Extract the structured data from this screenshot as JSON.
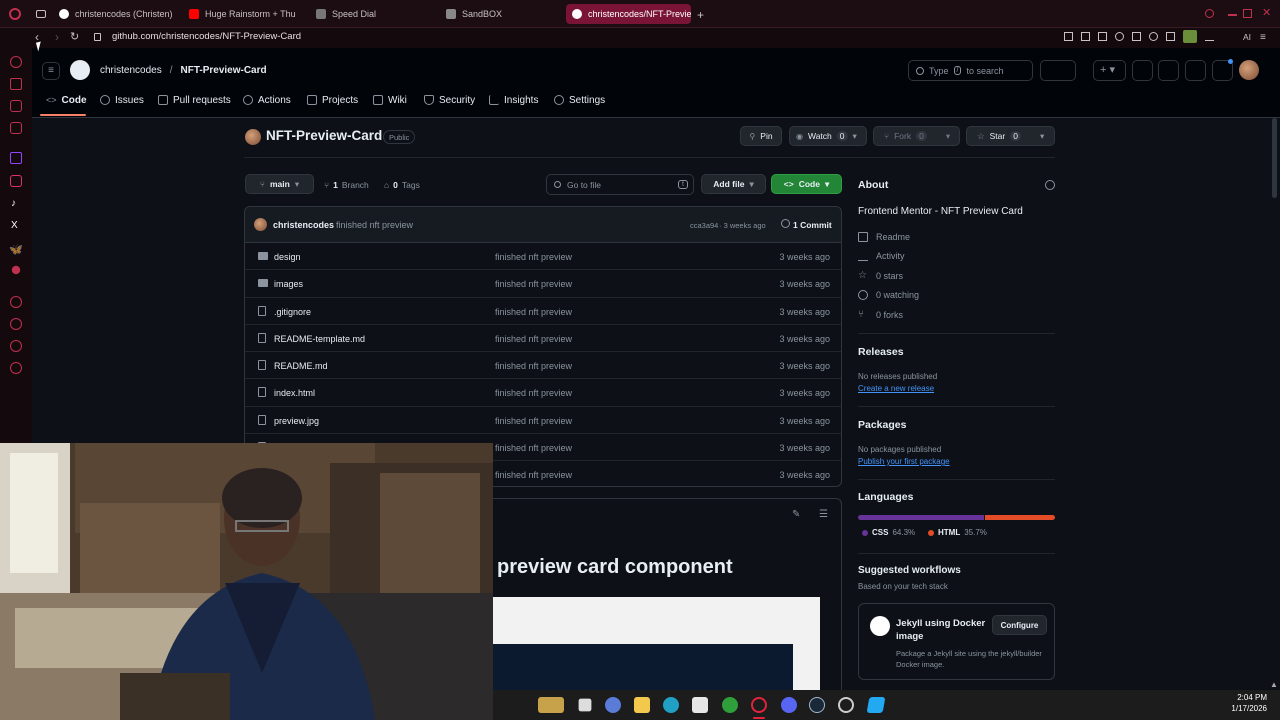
{
  "browser": {
    "tabs": [
      {
        "label": "christencodes (Christen)",
        "icon_color": "#ffffff"
      },
      {
        "label": "Huge Rainstorm + Thu",
        "icon_color": "#ff0000"
      },
      {
        "label": "Speed Dial",
        "icon_color": "#cfcfcf"
      },
      {
        "label": "SandBOX",
        "icon_color": "#cfcfcf"
      },
      {
        "label": "christencodes/NFT-Previe",
        "icon_color": "#ffffff",
        "active": true
      }
    ],
    "url": "github.com/christencodes/NFT-Preview-Card",
    "toolbar_ai": "AI",
    "accent": "#c0304f"
  },
  "header": {
    "owner": "christencodes",
    "separator": "/",
    "repo": "NFT-Preview-Card",
    "search_placeholder": "Type / to search",
    "search_key": "/",
    "search_prefix": "Type",
    "search_suffix": "to search"
  },
  "nav": {
    "tabs": [
      "Code",
      "Issues",
      "Pull requests",
      "Actions",
      "Projects",
      "Wiki",
      "Security",
      "Insights",
      "Settings"
    ]
  },
  "repo": {
    "title": "NFT-Preview-Card",
    "visibility": "Public",
    "pin": "Pin",
    "watch": "Watch",
    "watch_count": "0",
    "fork": "Fork",
    "fork_count": "0",
    "star": "Star",
    "star_count": "0"
  },
  "branchbar": {
    "branch": "main",
    "branches_count": "1",
    "branches_label": "Branch",
    "tags_count": "0",
    "tags_label": "Tags",
    "goto_placeholder": "Go to file",
    "goto_key": "t",
    "add_file": "Add file",
    "code": "Code"
  },
  "commit": {
    "author": "christencodes",
    "message": "finished nft preview",
    "hash": "cca3a94",
    "age": "· 3 weeks ago",
    "commits": "1 Commit"
  },
  "files": [
    {
      "name": "design",
      "type": "folder",
      "message": "finished nft preview",
      "date": "3 weeks ago"
    },
    {
      "name": "images",
      "type": "folder",
      "message": "finished nft preview",
      "date": "3 weeks ago"
    },
    {
      "name": ".gitignore",
      "type": "file",
      "message": "finished nft preview",
      "date": "3 weeks ago"
    },
    {
      "name": "README-template.md",
      "type": "file",
      "message": "finished nft preview",
      "date": "3 weeks ago"
    },
    {
      "name": "README.md",
      "type": "file",
      "message": "finished nft preview",
      "date": "3 weeks ago"
    },
    {
      "name": "index.html",
      "type": "file",
      "message": "finished nft preview",
      "date": "3 weeks ago"
    },
    {
      "name": "preview.jpg",
      "type": "file",
      "message": "finished nft preview",
      "date": "3 weeks ago"
    },
    {
      "name": "",
      "type": "file",
      "message": "finished nft preview",
      "date": "3 weeks ago"
    },
    {
      "name": "",
      "type": "file",
      "message": "finished nft preview",
      "date": "3 weeks ago"
    }
  ],
  "readme": {
    "heading": "preview card component"
  },
  "about": {
    "title": "About",
    "description": "Frontend Mentor - NFT Preview Card",
    "items": [
      "Readme",
      "Activity",
      "0 stars",
      "0 watching",
      "0 forks"
    ]
  },
  "releases": {
    "title": "Releases",
    "none": "No releases published",
    "link": "Create a new release"
  },
  "packages": {
    "title": "Packages",
    "none": "No packages published",
    "link": "Publish your first package"
  },
  "languages": {
    "title": "Languages",
    "items": [
      {
        "name": "CSS",
        "percent": "64.3%",
        "value": 64.3,
        "color": "#663399"
      },
      {
        "name": "HTML",
        "percent": "35.7%",
        "value": 35.7,
        "color": "#e34c26"
      }
    ]
  },
  "workflows": {
    "title": "Suggested workflows",
    "subtitle": "Based on your tech stack",
    "card_title": "Jekyll using Docker image",
    "card_desc": "Package a Jekyll site using the jekyll/builder Docker image.",
    "configure": "Configure"
  },
  "taskbar": {
    "time": "2:04 PM",
    "date": "1/17/2026"
  }
}
